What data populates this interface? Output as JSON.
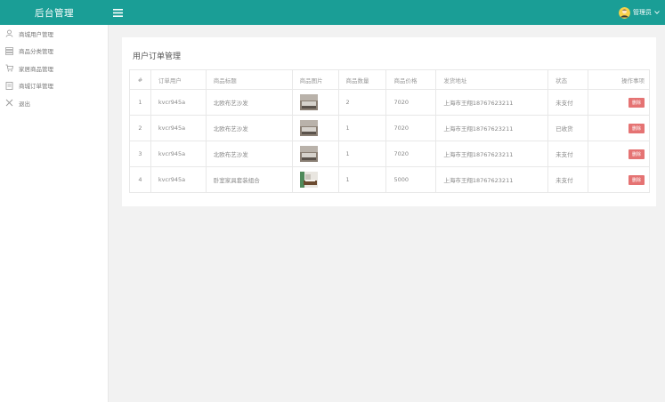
{
  "header": {
    "brand": "后台管理",
    "username": "管理员"
  },
  "sidebar": {
    "items": [
      {
        "label": "商城用户管理",
        "icon": "user-icon"
      },
      {
        "label": "商品分类管理",
        "icon": "list-icon"
      },
      {
        "label": "家居商品管理",
        "icon": "cart-icon"
      },
      {
        "label": "商城订单管理",
        "icon": "order-icon"
      },
      {
        "label": "退出",
        "icon": "close-icon"
      }
    ]
  },
  "main": {
    "title": "用户订单管理",
    "table": {
      "headers": [
        "#",
        "订单用户",
        "商品标题",
        "商品图片",
        "商品数量",
        "商品价格",
        "发货地址",
        "状态",
        "操作事项"
      ],
      "rows": [
        {
          "num": "1",
          "user": "kvcr945a",
          "title": "北欧布艺沙发",
          "qty": "2",
          "price": "7020",
          "address": "上海市王翔18767623211",
          "status": "未支付",
          "action": "删除"
        },
        {
          "num": "2",
          "user": "kvcr945a",
          "title": "北欧布艺沙发",
          "qty": "1",
          "price": "7020",
          "address": "上海市王翔18767623211",
          "status": "已收货",
          "action": "删除"
        },
        {
          "num": "3",
          "user": "kvcr945a",
          "title": "北欧布艺沙发",
          "qty": "1",
          "price": "7020",
          "address": "上海市王翔18767623211",
          "status": "未支付",
          "action": "删除"
        },
        {
          "num": "4",
          "user": "kvcr945a",
          "title": "卧室家具套装组合",
          "qty": "1",
          "price": "5000",
          "address": "上海市王翔18767623211",
          "status": "未支付",
          "action": "删除"
        }
      ]
    }
  },
  "colors": {
    "topbar": "#1a9e96",
    "delete_button": "#e57373",
    "page_background": "#f2f2f2"
  }
}
